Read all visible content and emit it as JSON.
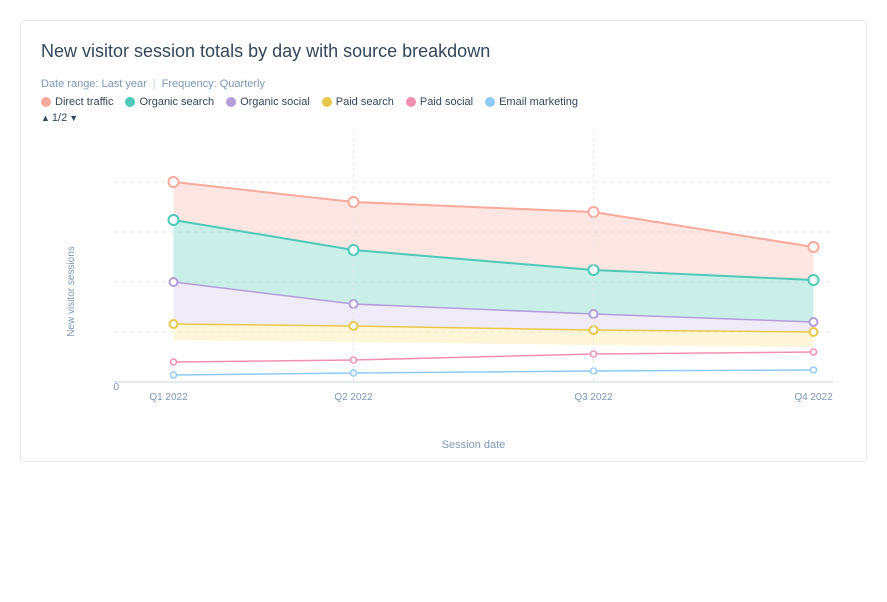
{
  "title": "New visitor session totals by day with source breakdown",
  "meta": {
    "date_range_label": "Date range: Last year",
    "frequency_label": "Frequency: Quarterly"
  },
  "legend": [
    {
      "label": "Direct traffic",
      "color": "#f8a99b",
      "type": "circle"
    },
    {
      "label": "Organic search",
      "color": "#4ec9b7",
      "type": "circle"
    },
    {
      "label": "Organic social",
      "color": "#b39ddb",
      "type": "circle"
    },
    {
      "label": "Paid search",
      "color": "#ffe082",
      "type": "circle"
    },
    {
      "label": "Paid social",
      "color": "#f48fb1",
      "type": "circle"
    },
    {
      "label": "Email marketing",
      "color": "#90caf9",
      "type": "circle"
    }
  ],
  "pagination": {
    "page": "1/2"
  },
  "xaxis": {
    "label": "Session date",
    "ticks": [
      "Q1 2022",
      "Q2 2022",
      "Q3 2022",
      "Q4 2022"
    ]
  },
  "yaxis": {
    "label": "New visitor sessions",
    "zero_label": "0"
  },
  "colors": {
    "direct": "#f8a99b",
    "organic_search": "#4ec9b7",
    "organic_social": "#b39ddb",
    "paid_search": "#ffe082",
    "paid_social": "#f48fb1",
    "email": "#90caf9"
  }
}
